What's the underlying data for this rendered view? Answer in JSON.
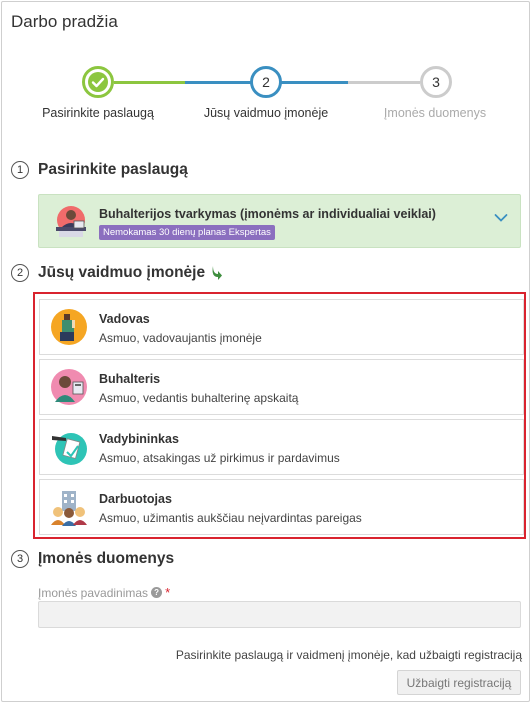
{
  "page_title": "Darbo pradžia",
  "stepper": {
    "steps": [
      {
        "label": "Pasirinkite paslaugą",
        "number": "1",
        "state": "done"
      },
      {
        "label": "Jūsų vaidmuo įmonėje",
        "number": "2",
        "state": "active"
      },
      {
        "label": "Įmonės duomenys",
        "number": "3",
        "state": "pending"
      }
    ],
    "colors": {
      "done": "#8cc63f",
      "active": "#3a8fc1",
      "pending": "#cccccc"
    }
  },
  "section1": {
    "number": "1",
    "title": "Pasirinkite paslaugą",
    "service": {
      "title": "Buhalterijos tvarkymas (įmonėms ar individualiai veiklai)",
      "badge": "Nemokamas 30 dienų planas Ekspertas",
      "icon": "accountant-desk-icon"
    }
  },
  "section2": {
    "number": "2",
    "title": "Jūsų vaidmuo įmonėje",
    "roles": [
      {
        "name": "Vadovas",
        "desc": "Asmuo, vadovaujantis įmonėje",
        "icon": "manager-icon"
      },
      {
        "name": "Buhalteris",
        "desc": "Asmuo, vedantis buhalterinę apskaitą",
        "icon": "accountant-icon"
      },
      {
        "name": "Vadybininkas",
        "desc": "Asmuo, atsakingas už pirkimus ir pardavimus",
        "icon": "sales-manager-icon"
      },
      {
        "name": "Darbuotojas",
        "desc": "Asmuo, užimantis aukščiau neįvardintas pareigas",
        "icon": "employee-icon"
      }
    ]
  },
  "section3": {
    "number": "3",
    "title": "Įmonės duomenys",
    "field_label": "Įmonės pavadinimas",
    "required_mark": "*",
    "help_glyph": "?",
    "field_value": ""
  },
  "footer": {
    "hint": "Pasirinkite paslaugą ir vaidmenį įmonėje, kad užbaigti registraciją",
    "submit_label": "Užbaigti registraciją"
  }
}
